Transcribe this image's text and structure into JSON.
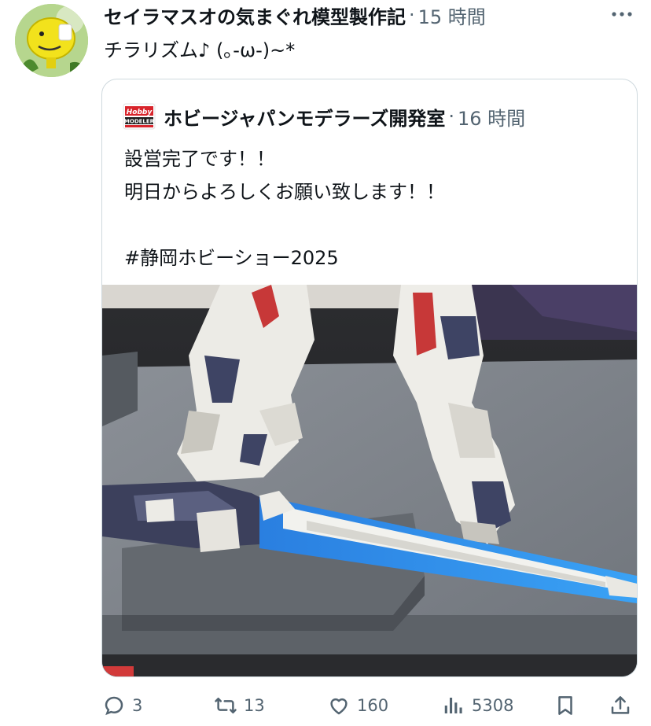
{
  "post": {
    "author_name": "セイラマスオの気まぐれ模型製作記",
    "separator": "·",
    "time": "15 時間",
    "text": "チラリズム♪ (｡-ω-)~*"
  },
  "quote": {
    "author_name": "ホビージャパンモデラーズ開発室",
    "separator": "·",
    "time": "16 時間",
    "body": "設営完了です！！\n明日からよろしくお願い致します！！\n\n#静岡ホビーショー2025",
    "logo_text": "Hobby MODELER"
  },
  "actions": {
    "reply_count": "3",
    "repost_count": "13",
    "like_count": "160",
    "view_count": "5308"
  },
  "icons": {
    "more": "more-horizontal-icon",
    "reply": "reply-icon",
    "repost": "repost-icon",
    "like": "heart-icon",
    "views": "views-chart-icon",
    "bookmark": "bookmark-icon",
    "share": "share-icon"
  },
  "colors": {
    "text": "#0f1419",
    "secondary": "#536471",
    "border": "#cfd9de"
  }
}
